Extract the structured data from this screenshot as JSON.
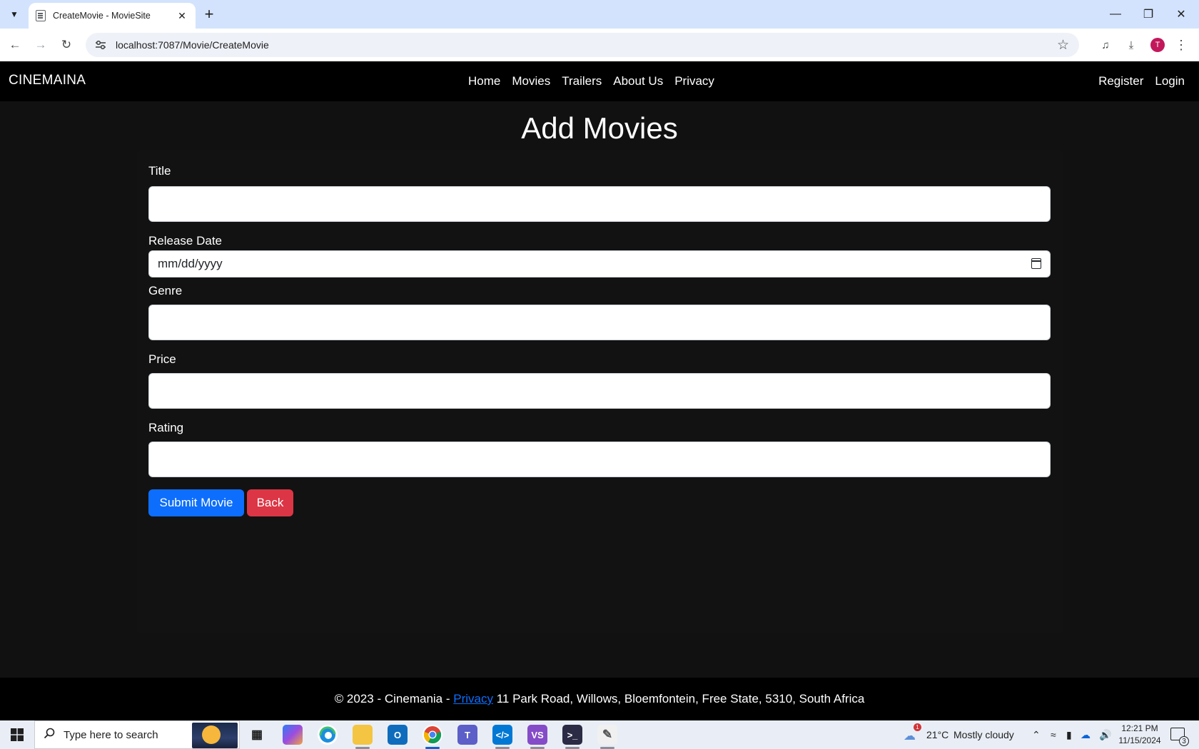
{
  "browser": {
    "tab_title": "CreateMovie - MovieSite",
    "url": "localhost:7087/Movie/CreateMovie",
    "profile_initial": "T"
  },
  "site": {
    "brand": "CINEMAINA",
    "nav_links": [
      "Home",
      "Movies",
      "Trailers",
      "About Us",
      "Privacy"
    ],
    "nav_right": [
      "Register",
      "Login"
    ]
  },
  "form": {
    "title": "Add Movies",
    "fields": {
      "title": {
        "label": "Title",
        "value": ""
      },
      "release_date": {
        "label": "Release Date",
        "placeholder": "mm/dd/yyyy"
      },
      "genre": {
        "label": "Genre",
        "value": ""
      },
      "price": {
        "label": "Price",
        "value": ""
      },
      "rating": {
        "label": "Rating",
        "value": ""
      }
    },
    "submit_label": "Submit Movie",
    "back_label": "Back"
  },
  "footer": {
    "prefix": "© 2023 - Cinemania - ",
    "link": "Privacy",
    "address": " 11 Park Road, Willows, Bloemfontein, Free State, 5310, South Africa"
  },
  "taskbar": {
    "search_placeholder": "Type here to search",
    "weather_temp": "21°C",
    "weather_desc": "Mostly cloudy",
    "weather_alert_count": "1",
    "time": "12:21 PM",
    "date": "11/15/2024",
    "notification_count": "3"
  },
  "colors": {
    "primary": "#0d6efd",
    "danger": "#dc3545",
    "navbar": "#000000",
    "page_background": "#111111"
  }
}
